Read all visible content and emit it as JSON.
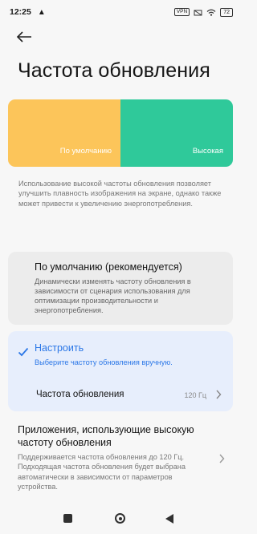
{
  "status_bar": {
    "time": "12:25",
    "notification_glyph": "▲",
    "vpn_label": "VPN",
    "battery": "72"
  },
  "header": {
    "back_icon": "arrow-left-icon",
    "title": "Частота обновления"
  },
  "preview": {
    "default_label": "По умолчанию",
    "high_label": "Высокая",
    "default_color": "#fcc55a",
    "high_color": "#2fc99a"
  },
  "description": "Использование высокой частоты обновления позволяет улучшить плавность изображения на экране, однако также может привести к увеличению энергопотребления.",
  "options": {
    "default": {
      "title": "По умолчанию (рекомендуется)",
      "subtitle": "Динамически изменять частоту обновления в зависимости от сценария использования для оптимизации производительности и энергопотребления.",
      "selected": false
    },
    "custom": {
      "title": "Настроить",
      "subtitle": "Выберите частоту обновления вручную.",
      "selected": true,
      "accent_color": "#2b77e7",
      "row_label": "Частота обновления",
      "row_value": "120 Гц"
    }
  },
  "apps": {
    "title": "Приложения, использующие высокую частоту обновления",
    "subtitle": "Поддерживается частота обновления до 120 Гц. Подходящая частота обновления будет выбрана автоматически в зависимости от параметров устройства."
  },
  "nav": {
    "recents_icon": "square-icon",
    "home_icon": "circle-icon",
    "back_icon": "triangle-back-icon"
  }
}
